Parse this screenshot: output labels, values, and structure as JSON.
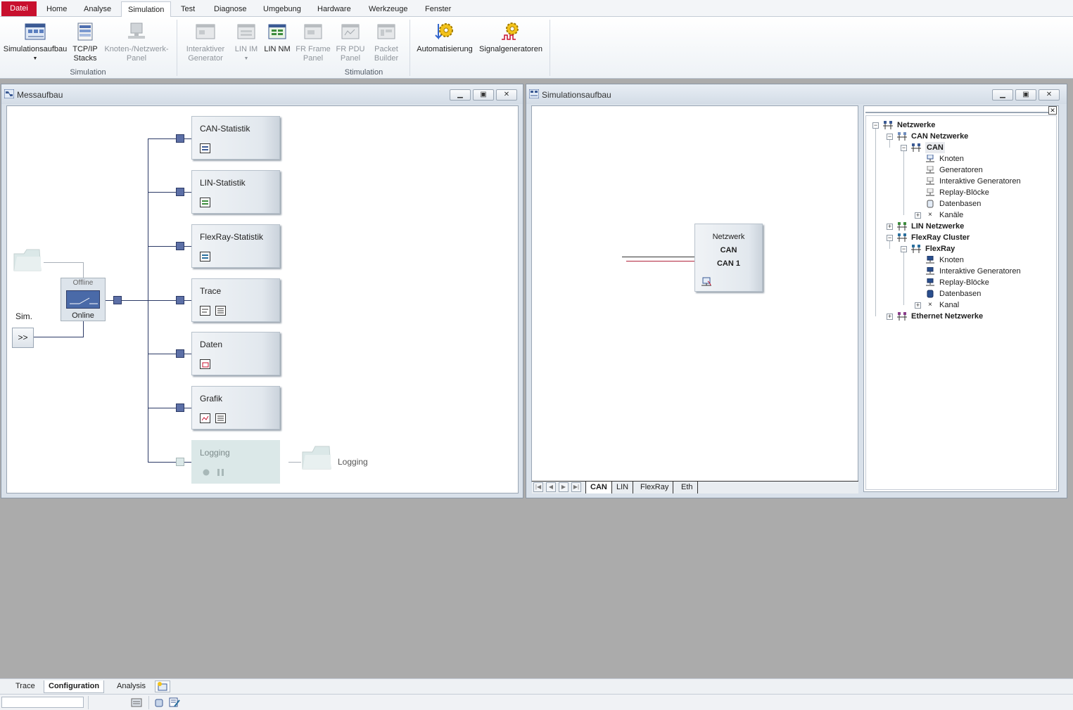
{
  "ribbon": {
    "tabs": [
      "Datei",
      "Home",
      "Analyse",
      "Simulation",
      "Test",
      "Diagnose",
      "Umgebung",
      "Hardware",
      "Werkzeuge",
      "Fenster"
    ],
    "active_tab": "Simulation",
    "buttons": {
      "simulationsaufbau": "Simulationsaufbau",
      "tcpip_1": "TCP/IP",
      "tcpip_2": "Stacks",
      "knoten_1": "Knoten-/Netzwerk-",
      "knoten_2": "Panel",
      "interaktiv_1": "Interaktiver",
      "interaktiv_2": "Generator",
      "linim": "LIN IM",
      "linnm": "LIN NM",
      "frframe_1": "FR Frame",
      "frframe_2": "Panel",
      "frpdu_1": "FR PDU",
      "frpdu_2": "Panel",
      "packet_1": "Packet",
      "packet_2": "Builder",
      "automatisierung": "Automatisierung",
      "signalgeneratoren": "Signalgeneratoren"
    },
    "groups": {
      "simulation_1": "Simulation",
      "simulation_2": "Stimulation"
    }
  },
  "messaufbau": {
    "title": "Messaufbau",
    "offline": "Offline",
    "online": "Online",
    "sim": "Sim.",
    "sim_button": ">>",
    "blocks": [
      "CAN-Statistik",
      "LIN-Statistik",
      "FlexRay-Statistik",
      "Trace",
      "Daten",
      "Grafik",
      "Logging"
    ],
    "logging_file": "Logging"
  },
  "simulationsaufbau": {
    "title": "Simulationsaufbau",
    "network_block": {
      "line1": "Netzwerk",
      "line2": "CAN",
      "line3": "CAN 1"
    },
    "tabs": [
      "CAN",
      "LIN",
      "FlexRay",
      "Eth"
    ],
    "active_tab": "CAN",
    "tree": {
      "root": "Netzwerke",
      "can_netzwerke": "CAN Netzwerke",
      "can": "CAN",
      "can_knoten": "Knoten",
      "can_generatoren": "Generatoren",
      "can_interaktiv": "Interaktive Generatoren",
      "can_replay": "Replay-Blöcke",
      "can_datenbasen": "Datenbasen",
      "can_kanaele": "Kanäle",
      "lin_netzwerke": "LIN Netzwerke",
      "flexray_cluster": "FlexRay Cluster",
      "flexray": "FlexRay",
      "fr_knoten": "Knoten",
      "fr_interaktiv": "Interaktive Generatoren",
      "fr_replay": "Replay-Blöcke",
      "fr_datenbasen": "Datenbasen",
      "fr_kanal": "Kanal",
      "ethernet_netzwerke": "Ethernet Netzwerke"
    }
  },
  "bottom_tabs": [
    "Trace",
    "Configuration",
    "Analysis"
  ],
  "bottom_active": "Configuration",
  "colors": {
    "file_tab": "#c8102e",
    "accent_node": "#5c6fa6",
    "workspace": "#ababab"
  }
}
